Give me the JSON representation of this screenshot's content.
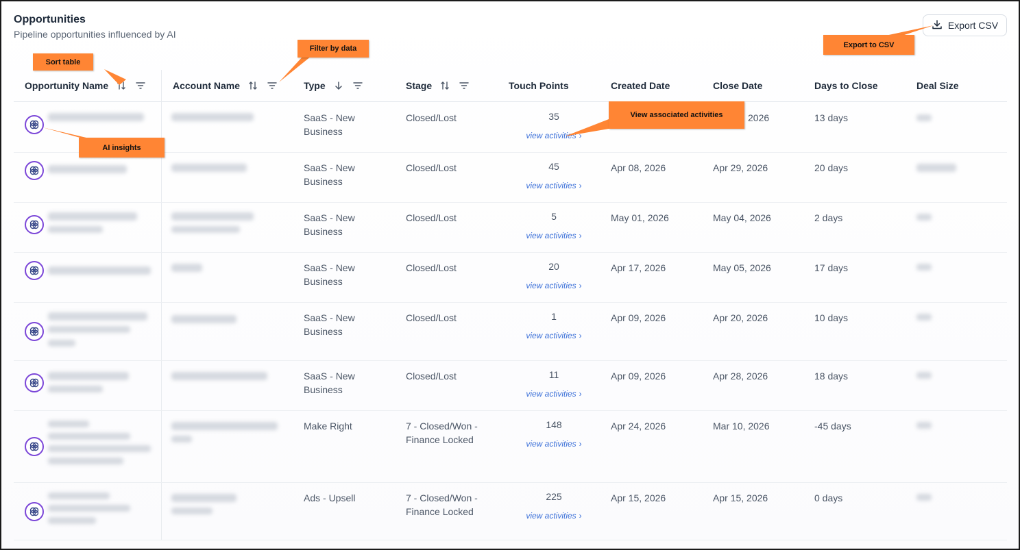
{
  "header": {
    "title": "Opportunities",
    "subtitle": "Pipeline opportunities influenced by AI",
    "export_label": "Export CSV",
    "export_icon": "download-icon"
  },
  "columns": {
    "opportunity": "Opportunity Name",
    "account": "Account Name",
    "type": "Type",
    "stage": "Stage",
    "touch": "Touch Points",
    "created": "Created Date",
    "close": "Close Date",
    "days": "Days to Close",
    "deal": "Deal Size"
  },
  "rows": [
    {
      "type1": "SaaS - New",
      "type2": "Business",
      "stage1": "Closed/Lost",
      "stage2": "",
      "touch": "35",
      "link": "view activities",
      "created": "",
      "close": "2026",
      "days": "13 days"
    },
    {
      "type1": "SaaS - New",
      "type2": "Business",
      "stage1": "Closed/Lost",
      "stage2": "",
      "touch": "45",
      "link": "view activities",
      "created": "Apr 08, 2026",
      "close": "Apr 29, 2026",
      "days": "20 days"
    },
    {
      "type1": "SaaS - New",
      "type2": "Business",
      "stage1": "Closed/Lost",
      "stage2": "",
      "touch": "5",
      "link": "view activities",
      "created": "May 01, 2026",
      "close": "May 04, 2026",
      "days": "2 days"
    },
    {
      "type1": "SaaS - New",
      "type2": "Business",
      "stage1": "Closed/Lost",
      "stage2": "",
      "touch": "20",
      "link": "view activities",
      "created": "Apr 17, 2026",
      "close": "May 05, 2026",
      "days": "17 days"
    },
    {
      "type1": "SaaS - New",
      "type2": "Business",
      "stage1": "Closed/Lost",
      "stage2": "",
      "touch": "1",
      "link": "view activities",
      "created": "Apr 09, 2026",
      "close": "Apr 20, 2026",
      "days": "10 days"
    },
    {
      "type1": "SaaS - New",
      "type2": "Business",
      "stage1": "Closed/Lost",
      "stage2": "",
      "touch": "11",
      "link": "view activities",
      "created": "Apr 09, 2026",
      "close": "Apr 28, 2026",
      "days": "18 days"
    },
    {
      "type1": "Make Right",
      "type2": "",
      "stage1": "7 - Closed/Won -",
      "stage2": "Finance Locked",
      "touch": "148",
      "link": "view activities",
      "created": "Apr 24, 2026",
      "close": "Mar 10, 2026",
      "days": "-45 days"
    },
    {
      "type1": "Ads - Upsell",
      "type2": "",
      "stage1": "7 - Closed/Won -",
      "stage2": "Finance Locked",
      "touch": "225",
      "link": "view activities",
      "created": "Apr 15, 2026",
      "close": "Apr 15, 2026",
      "days": "0 days"
    }
  ],
  "callouts": {
    "sort": "Sort table",
    "filter": "Filter by data",
    "export": "Export to CSV",
    "activities": "View associated activities",
    "ai": "AI insights"
  },
  "colors": {
    "callout": "#ff8534",
    "link": "#3a6fd8",
    "ai_ring": "#7b46d8"
  }
}
